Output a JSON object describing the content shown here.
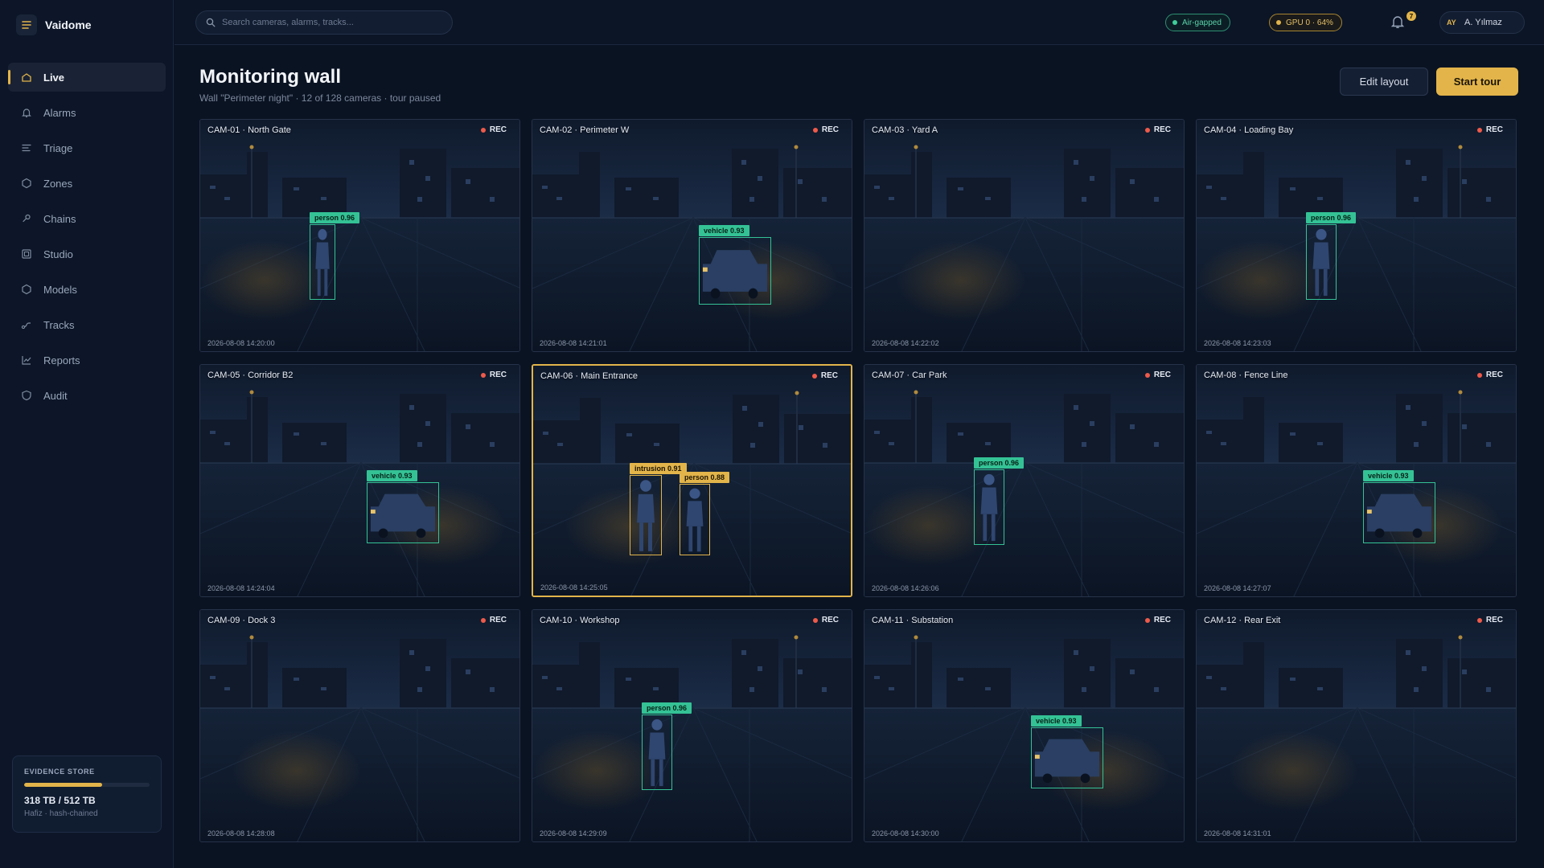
{
  "app": {
    "name": "Vaidome"
  },
  "nav": [
    {
      "label": "Live",
      "icon": "home-icon",
      "active": true
    },
    {
      "label": "Alarms",
      "icon": "bell-icon"
    },
    {
      "label": "Triage",
      "icon": "list-icon"
    },
    {
      "label": "Zones",
      "icon": "hexagon-icon"
    },
    {
      "label": "Chains",
      "icon": "link-icon"
    },
    {
      "label": "Studio",
      "icon": "studio-icon"
    },
    {
      "label": "Models",
      "icon": "cube-icon"
    },
    {
      "label": "Tracks",
      "icon": "route-icon"
    },
    {
      "label": "Reports",
      "icon": "chart-icon"
    },
    {
      "label": "Audit",
      "icon": "shield-icon"
    }
  ],
  "evidence": {
    "title": "EVIDENCE STORE",
    "used_fraction": 0.62,
    "size": "318 TB / 512 TB",
    "sub": "Hafiz · hash-chained"
  },
  "topbar": {
    "search_placeholder": "Search cameras, alarms, tracks...",
    "air_gapped": "Air-gapped",
    "gpu": "GPU 0 · 64%",
    "notifications": "7",
    "user_initials": "AY",
    "user_name": "A. Yılmaz"
  },
  "header": {
    "title": "Monitoring wall",
    "subtitle": "Wall \"Perimeter night\" · 12 of 128 cameras · tour paused",
    "edit_label": "Edit layout",
    "tour_label": "Start tour"
  },
  "rec_label": "REC",
  "cameras": [
    {
      "label": "CAM-01 · North Gate",
      "time": "2026-08-08 14:20:00",
      "detections": [
        {
          "tag": "person 0.96",
          "kind": "person"
        }
      ]
    },
    {
      "label": "CAM-02 · Perimeter W",
      "time": "2026-08-08 14:21:01",
      "detections": [
        {
          "tag": "vehicle 0.93",
          "kind": "vehicle"
        }
      ]
    },
    {
      "label": "CAM-03 · Yard A",
      "time": "2026-08-08 14:22:02",
      "detections": []
    },
    {
      "label": "CAM-04 · Loading Bay",
      "time": "2026-08-08 14:23:03",
      "detections": [
        {
          "tag": "person 0.96",
          "kind": "person"
        }
      ]
    },
    {
      "label": "CAM-05 · Corridor B2",
      "time": "2026-08-08 14:24:04",
      "detections": [
        {
          "tag": "vehicle 0.93",
          "kind": "vehicle"
        }
      ]
    },
    {
      "label": "CAM-06 · Main Entrance",
      "time": "2026-08-08 14:25:05",
      "selected": true,
      "detections": [
        {
          "tag": "intrusion 0.91",
          "kind": "person"
        },
        {
          "tag": "person 0.88",
          "kind": "person"
        }
      ]
    },
    {
      "label": "CAM-07 · Car Park",
      "time": "2026-08-08 14:26:06",
      "detections": [
        {
          "tag": "person 0.96",
          "kind": "person"
        }
      ]
    },
    {
      "label": "CAM-08 · Fence Line",
      "time": "2026-08-08 14:27:07",
      "detections": [
        {
          "tag": "vehicle 0.93",
          "kind": "vehicle"
        }
      ]
    },
    {
      "label": "CAM-09 · Dock 3",
      "time": "2026-08-08 14:28:08",
      "detections": []
    },
    {
      "label": "CAM-10 · Workshop",
      "time": "2026-08-08 14:29:09",
      "detections": [
        {
          "tag": "person 0.96",
          "kind": "person"
        }
      ]
    },
    {
      "label": "CAM-11 · Substation",
      "time": "2026-08-08 14:30:00",
      "detections": [
        {
          "tag": "vehicle 0.93",
          "kind": "vehicle"
        }
      ]
    },
    {
      "label": "CAM-12 · Rear Exit",
      "time": "2026-08-08 14:31:01",
      "detections": []
    }
  ],
  "colors": {
    "accent": "#e2b44a",
    "detection": "#34c295",
    "rec": "#ef5a4a",
    "air_gapped": "#3ecf9a"
  }
}
